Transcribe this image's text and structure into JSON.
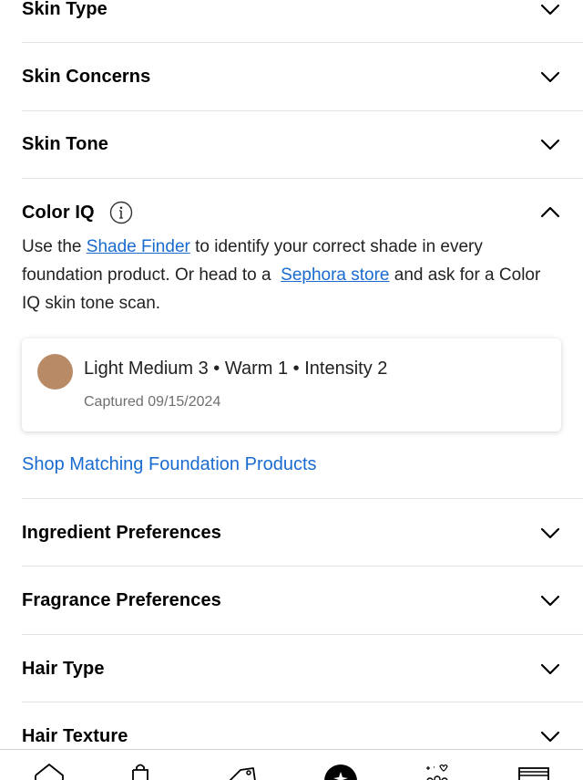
{
  "sections_top": [
    {
      "label": "Skin Type"
    },
    {
      "label": "Skin Concerns"
    },
    {
      "label": "Skin Tone"
    }
  ],
  "color_iq": {
    "title": "Color IQ",
    "desc_part1": "Use the ",
    "shade_finder_link": "Shade Finder",
    "desc_part2": " to identify your correct shade in every foundation product. Or head to a  ",
    "store_link": "Sephora store",
    "desc_part3": " and ask for a Color IQ skin tone scan.",
    "card": {
      "swatch_color": "#b88a66",
      "shade": "Light Medium 3 • Warm 1 • Intensity 2",
      "captured": "Captured 09/15/2024"
    },
    "shop_link": "Shop Matching Foundation Products"
  },
  "sections_bottom": [
    {
      "label": "Ingredient Preferences"
    },
    {
      "label": "Fragrance Preferences"
    },
    {
      "label": "Hair Type"
    },
    {
      "label": "Hair Texture"
    }
  ],
  "bottom_nav": [
    {
      "icon": "home-icon"
    },
    {
      "icon": "shop-bag-icon"
    },
    {
      "icon": "offers-tag-icon"
    },
    {
      "icon": "beauty-insider-icon"
    },
    {
      "icon": "community-icon"
    },
    {
      "icon": "store-icon"
    }
  ],
  "colors": {
    "link": "#1a6bd0",
    "divider": "#e3e3e3"
  }
}
